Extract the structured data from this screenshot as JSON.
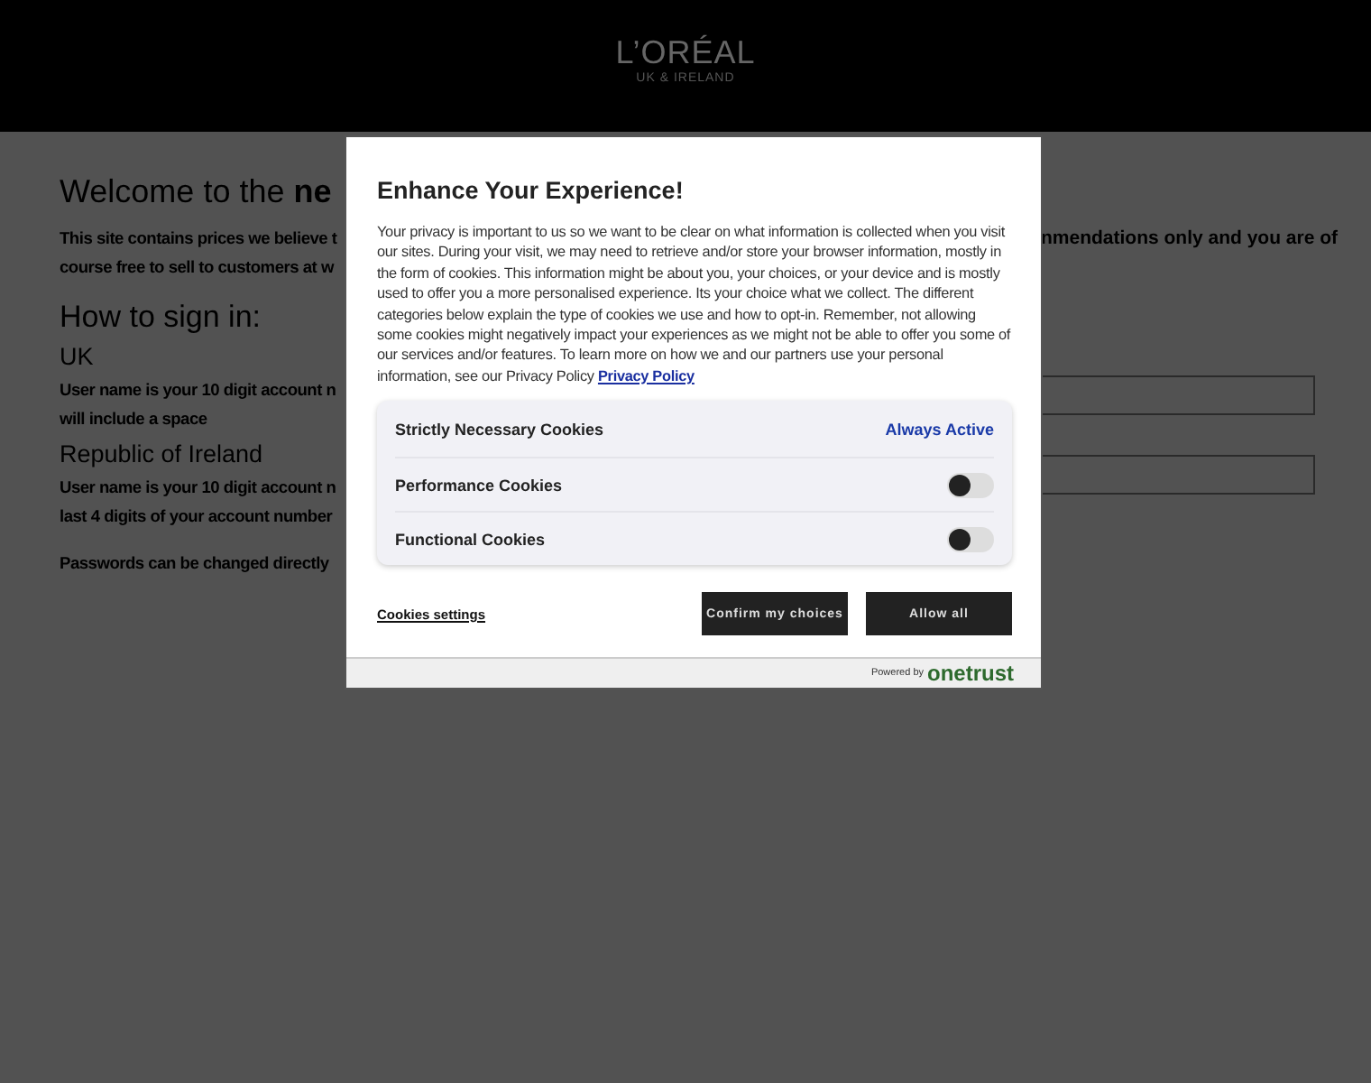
{
  "header": {
    "logo": "L’ORÉAL",
    "logo_subtitle": "UK & IRELAND"
  },
  "page": {
    "heading": "Welcome to the **ne**",
    "intro_lines": [
      "This site contains prices we believe t",
      "course free to sell to customers at w"
    ],
    "intro_right": "nmendations only and you are of",
    "sign_in_heading": "How to sign in:",
    "sections": [
      {
        "title": "UK",
        "lines": [
          "User name is your 10 digit account n",
          "will include a space"
        ]
      },
      {
        "title": "Republic of Ireland",
        "lines": [
          "User name is your 10 digit account n",
          "last 4 digits of your account number"
        ]
      }
    ],
    "note": "Passwords can be changed directly",
    "fields": [
      {
        "kind": "input"
      },
      {
        "kind": "input"
      }
    ]
  },
  "cookie_dialog": {
    "title": "Enhance Your Experience!",
    "body": "Your privacy is important to us so we want to be clear on what information is collected when you visit our sites. During your visit, we may need to retrieve and/or store your browser information, mostly in the form of cookies. This information might be about you, your choices, or your device and is mostly used to offer you a more personalised experience. Its your choice what we collect. The different categories below explain the type of cookies we use and how to opt-in. Remember, not allowing some cookies might negatively impact your experiences as we might not be able to offer you some of our services and/or features. To learn more on how we and our partners use your personal information, see our Privacy Policy",
    "policy_link": "Privacy Policy",
    "categories": [
      {
        "kind": "always",
        "label": "Strictly Necessary Cookies",
        "status": "Always Active"
      },
      {
        "kind": "toggle",
        "label": "Performance Cookies",
        "on": false
      },
      {
        "kind": "toggle",
        "label": "Functional Cookies",
        "on": false
      }
    ],
    "settings_link": "Cookies settings",
    "buttons": [
      "Confirm my choices",
      "Allow all"
    ],
    "powered_by": "Powered by",
    "brand": "onetrust"
  }
}
